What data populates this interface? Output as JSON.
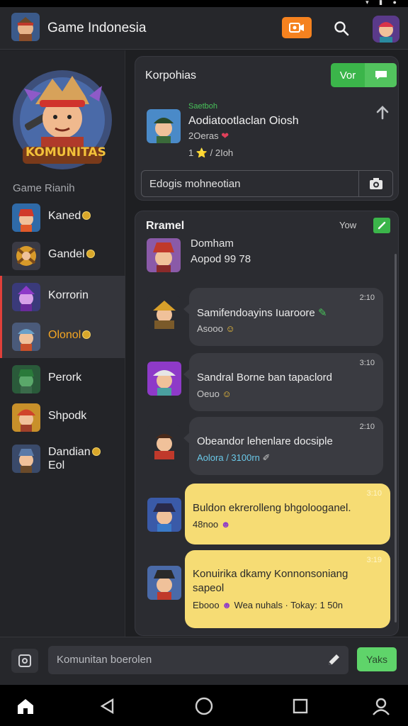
{
  "colors": {
    "accent_green": "#3bb54a",
    "accent_orange": "#f5821f",
    "bubble_yellow": "#f6dc74",
    "active_marker": "#e0403a"
  },
  "statusbar": {
    "icons": "▾ ▮ ●"
  },
  "appbar": {
    "title": "Game Indonesia",
    "icons": [
      "video-icon",
      "search-icon",
      "profile-avatar"
    ]
  },
  "sidebar": {
    "section_label": "Game Rianih",
    "items": [
      {
        "label": "Kaned",
        "has_coin": true,
        "active": false
      },
      {
        "label": "Gandel",
        "has_coin": true,
        "active": false
      },
      {
        "label": "Korrorin",
        "has_coin": false,
        "active": true
      },
      {
        "label": "Olonol",
        "has_coin": true,
        "active": true,
        "accent": "#f5a623"
      },
      {
        "label": "Perork",
        "has_coin": false,
        "active": false
      },
      {
        "label": "Shpodk",
        "has_coin": false,
        "active": false
      },
      {
        "label": "Dandian",
        "label2": "Eol",
        "has_coin": true,
        "active": false
      }
    ],
    "hero_label": "KOMUNITAS"
  },
  "post_card": {
    "title": "Korpohias",
    "vote_label": "Vor",
    "post": {
      "tag": "Saetboh",
      "title": "Aodiatootlaclan Oiosh",
      "meta1": "2Oeras",
      "meta2": "1 ⭐ / 2Ioh"
    },
    "input_value": "Edogis mohneotian"
  },
  "chat_card": {
    "title": "Rramel",
    "badge_label": "Yow",
    "header": {
      "name": "Domham",
      "sub": "Aopod 99 78"
    },
    "messages": [
      {
        "time": "2:10",
        "text": "Samifendoayins Iuaroore",
        "meta": "Asooo",
        "style": "dark"
      },
      {
        "time": "3:10",
        "text": "Sandral Borne ban tapaclord",
        "meta": "Oeuo",
        "style": "dark"
      },
      {
        "time": "2:10",
        "text": "Obeandor lehenlare docsiple",
        "meta": "Aolora / 3100rn",
        "style": "dark"
      },
      {
        "time": "3:10",
        "text": "Buldon ekrerolleng bhgolooganel.",
        "meta": "48noo",
        "style": "yellow"
      },
      {
        "time": "3:19",
        "text": "Konuirika dkamy Konnonsoniang",
        "text2": "sapeol",
        "meta": "Wea nuhals · Tokay: 1 50n",
        "meta_prefix": "Ebooo",
        "style": "yellow"
      }
    ]
  },
  "composer": {
    "placeholder": "Komunitan boerolen",
    "send_label": "Yaks"
  },
  "navbar": {
    "icons": [
      "home-icon",
      "back-icon",
      "circle-home-icon",
      "recents-icon",
      "person-icon"
    ]
  }
}
